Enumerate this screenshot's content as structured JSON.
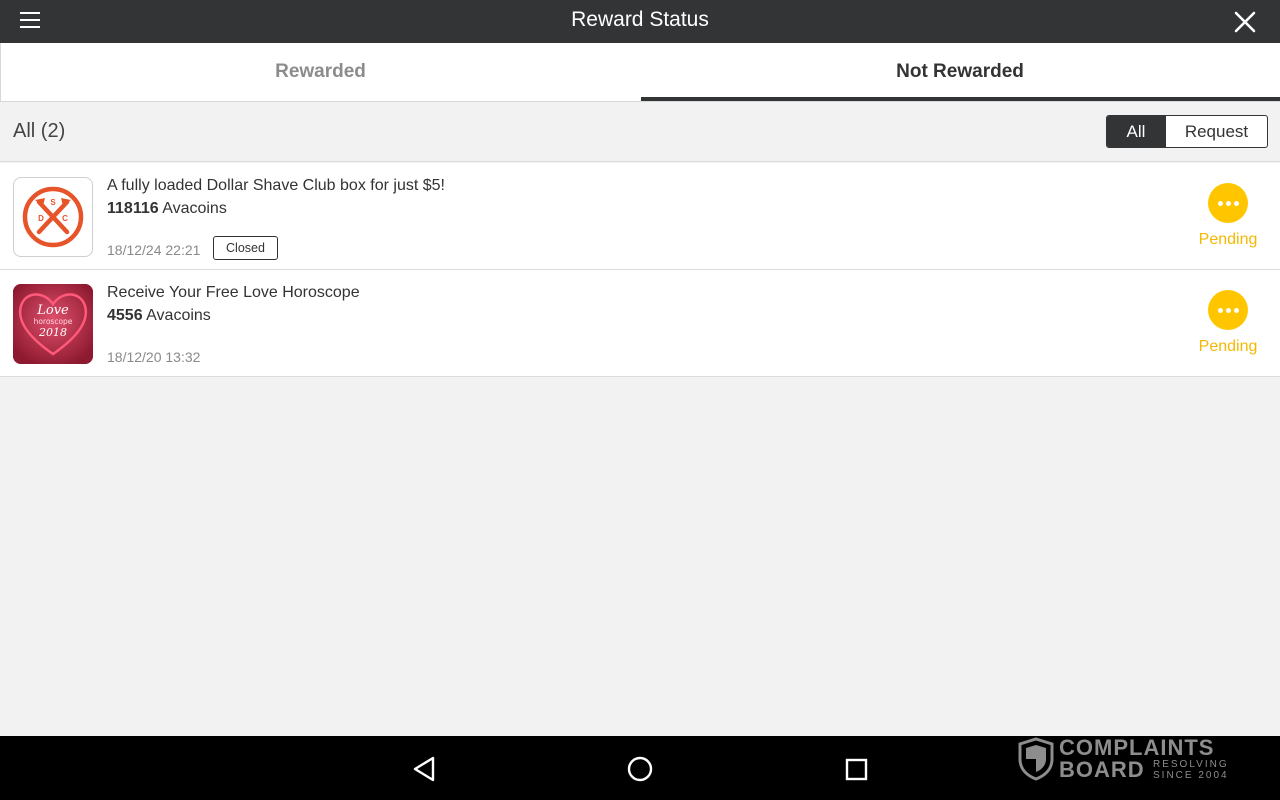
{
  "header": {
    "title": "Reward Status",
    "menu_icon": "hamburger-menu-icon",
    "close_icon": "close-icon"
  },
  "tabs": [
    {
      "label": "Rewarded",
      "active": false
    },
    {
      "label": "Not Rewarded",
      "active": true
    }
  ],
  "filter": {
    "count_label": "All (2)",
    "options": [
      {
        "label": "All",
        "selected": true
      },
      {
        "label": "Request",
        "selected": false
      }
    ]
  },
  "items": [
    {
      "title": "A fully loaded Dollar Shave Club box for just $5!",
      "amount": "118116",
      "unit": "Avacoins",
      "date": "18/12/24 22:21",
      "badge": "Closed",
      "status": "Pending",
      "thumb_icon": "dollar-shave-club-logo",
      "thumb_letters": [
        "S",
        "D",
        "C"
      ]
    },
    {
      "title": "Receive Your Free Love Horoscope",
      "amount": "4556",
      "unit": "Avacoins",
      "date": "18/12/20 13:32",
      "badge": "",
      "status": "Pending",
      "thumb_icon": "love-horoscope-heart-image",
      "thumb_text": {
        "line1": "Love",
        "line2": "horoscope",
        "line3": "2018"
      }
    }
  ],
  "nav": {
    "back_icon": "back-triangle-icon",
    "home_icon": "home-circle-icon",
    "recents_icon": "recents-square-icon"
  },
  "watermark": {
    "line1": "COMPLAINTS",
    "line2": "BOARD",
    "tag1": "RESOLVING",
    "tag2": "SINCE 2004"
  },
  "colors": {
    "header_bg": "#333436",
    "accent_pending": "#ffc600",
    "pending_text": "#f5b800",
    "dsc_orange": "#e8542a",
    "love_red": "#b8253f"
  }
}
